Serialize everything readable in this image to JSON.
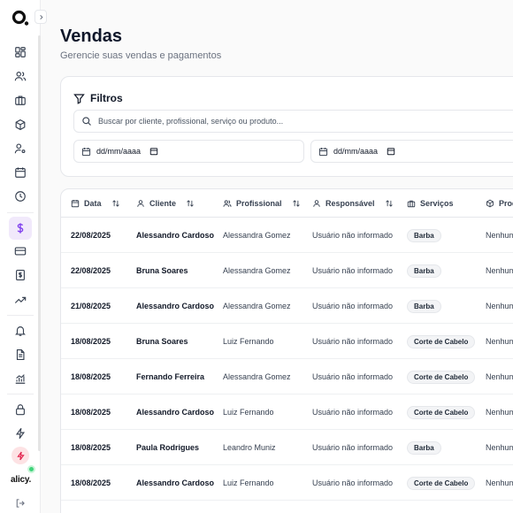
{
  "page": {
    "title": "Vendas",
    "subtitle": "Gerencie suas vendas e pagamentos"
  },
  "sidebar": {
    "brand": "alicy.",
    "items": [
      {
        "icon": "dashboard-icon"
      },
      {
        "icon": "users-icon"
      },
      {
        "icon": "briefcase-icon"
      },
      {
        "icon": "package-icon"
      },
      {
        "icon": "user-settings-icon"
      },
      {
        "icon": "calendar-icon"
      },
      {
        "icon": "clock-icon"
      },
      {
        "icon": "dollar-icon",
        "active": true
      },
      {
        "icon": "credit-card-icon"
      },
      {
        "icon": "receipt-dollar-icon"
      },
      {
        "icon": "trending-up-icon"
      },
      {
        "icon": "bell-icon"
      },
      {
        "icon": "document-icon"
      },
      {
        "icon": "analytics-icon"
      },
      {
        "icon": "lock-icon"
      },
      {
        "icon": "zap-icon"
      }
    ],
    "accent_color": "#7c3aed",
    "active_bg": "#f1e9fb"
  },
  "filters": {
    "title": "Filtros",
    "search_placeholder": "Buscar por cliente, profissional, serviço ou produto...",
    "date_from": "dd/mm/aaaa",
    "date_to": "dd/mm/aaaa"
  },
  "table": {
    "columns": [
      "Data",
      "Cliente",
      "Profissional",
      "Responsável",
      "Serviços",
      "Prod"
    ],
    "rows": [
      {
        "date": "22/08/2025",
        "client": "Alessandro Cardoso",
        "professional": "Alessandra Gomez",
        "responsible": "Usuário não informado",
        "service": "Barba",
        "product": "Nenhum"
      },
      {
        "date": "22/08/2025",
        "client": "Bruna Soares",
        "professional": "Alessandra Gomez",
        "responsible": "Usuário não informado",
        "service": "Barba",
        "product": "Nenhum"
      },
      {
        "date": "21/08/2025",
        "client": "Alessandro Cardoso",
        "professional": "Alessandra Gomez",
        "responsible": "Usuário não informado",
        "service": "Barba",
        "product": "Nenhum"
      },
      {
        "date": "18/08/2025",
        "client": "Bruna Soares",
        "professional": "Luiz Fernando",
        "responsible": "Usuário não informado",
        "service": "Corte de Cabelo",
        "product": "Nenhum"
      },
      {
        "date": "18/08/2025",
        "client": "Fernando Ferreira",
        "professional": "Alessandra Gomez",
        "responsible": "Usuário não informado",
        "service": "Corte de Cabelo",
        "product": "Nenhum"
      },
      {
        "date": "18/08/2025",
        "client": "Alessandro Cardoso",
        "professional": "Luiz Fernando",
        "responsible": "Usuário não informado",
        "service": "Corte de Cabelo",
        "product": "Nenhum"
      },
      {
        "date": "18/08/2025",
        "client": "Paula Rodrigues",
        "professional": "Leandro Muniz",
        "responsible": "Usuário não informado",
        "service": "Barba",
        "product": "Nenhum"
      },
      {
        "date": "18/08/2025",
        "client": "Alessandro Cardoso",
        "professional": "Luiz Fernando",
        "responsible": "Usuário não informado",
        "service": "Corte de Cabelo",
        "product": "Nenhum"
      }
    ]
  }
}
